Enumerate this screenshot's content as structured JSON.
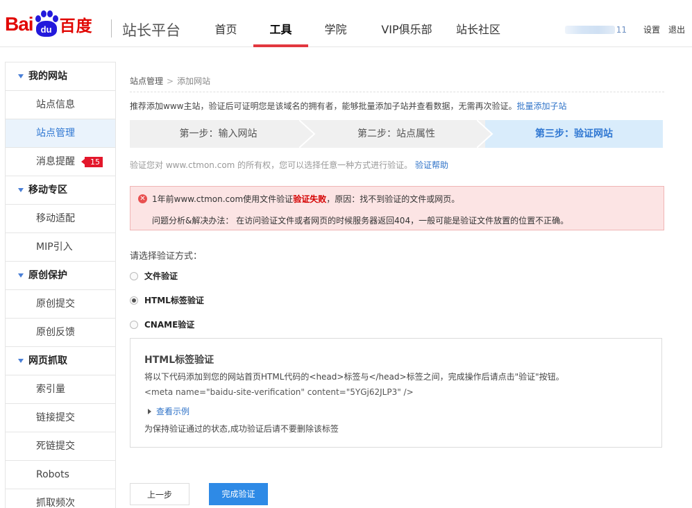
{
  "header": {
    "logo_bai": "Bai",
    "logo_du": "du",
    "logo_cn": "百度",
    "site_title": "站长平台",
    "nav": [
      "首页",
      "工具",
      "学院",
      "VIP俱乐部",
      "站长社区"
    ],
    "active_nav": "工具",
    "username_suffix": "11",
    "settings": "设置",
    "logout": "退出"
  },
  "sidebar": {
    "groups": [
      {
        "label": "我的网站",
        "items": [
          "站点信息",
          "站点管理",
          "消息提醒"
        ]
      },
      {
        "label": "移动专区",
        "items": [
          "移动适配",
          "MIP引入"
        ]
      },
      {
        "label": "原创保护",
        "items": [
          "原创提交",
          "原创反馈"
        ]
      },
      {
        "label": "网页抓取",
        "items": [
          "索引量",
          "链接提交",
          "死链提交",
          "Robots",
          "抓取频次"
        ]
      }
    ],
    "active_item": "站点管理",
    "message_badge": "15"
  },
  "main": {
    "breadcrumb": [
      "站点管理",
      "添加网站"
    ],
    "tip": "推荐添加www主站，验证后可证明您是该域名的拥有者，能够批量添加子站并查看数据，无需再次验证。",
    "tip_link": "批量添加子站",
    "steps": [
      "第一步：输入网站",
      "第二步：站点属性",
      "第三步：验证网站"
    ],
    "active_step": 2,
    "verify_tip": "验证您对 www.ctmon.com 的所有权，您可以选择任意一种方式进行验证。",
    "verify_help": "验证帮助",
    "error": {
      "line1_pre": "1年前www.ctmon.com使用文件验证",
      "line1_strong": "验证失败",
      "line1_post": "，原因：找不到验证的文件或网页。",
      "line2": "问题分析&解决办法： 在访问验证文件或者网页的时候服务器返回404，一般可能是验证文件放置的位置不正确。"
    },
    "choose_label": "请选择验证方式：",
    "methods": [
      "文件验证",
      "HTML标签验证",
      "CNAME验证"
    ],
    "selected_method": "HTML标签验证",
    "panel": {
      "title": "HTML标签验证",
      "desc": "将以下代码添加到您的网站首页HTML代码的<head>标签与</head>标签之间，完成操作后请点击\"验证\"按钮。",
      "code": "<meta name=\"baidu-site-verification\" content=\"5YGj62JLP3\" />",
      "example": "查看示例",
      "note": "为保持验证通过的状态,成功验证后请不要删除该标签"
    },
    "buttons": {
      "prev": "上一步",
      "done": "完成验证"
    }
  }
}
